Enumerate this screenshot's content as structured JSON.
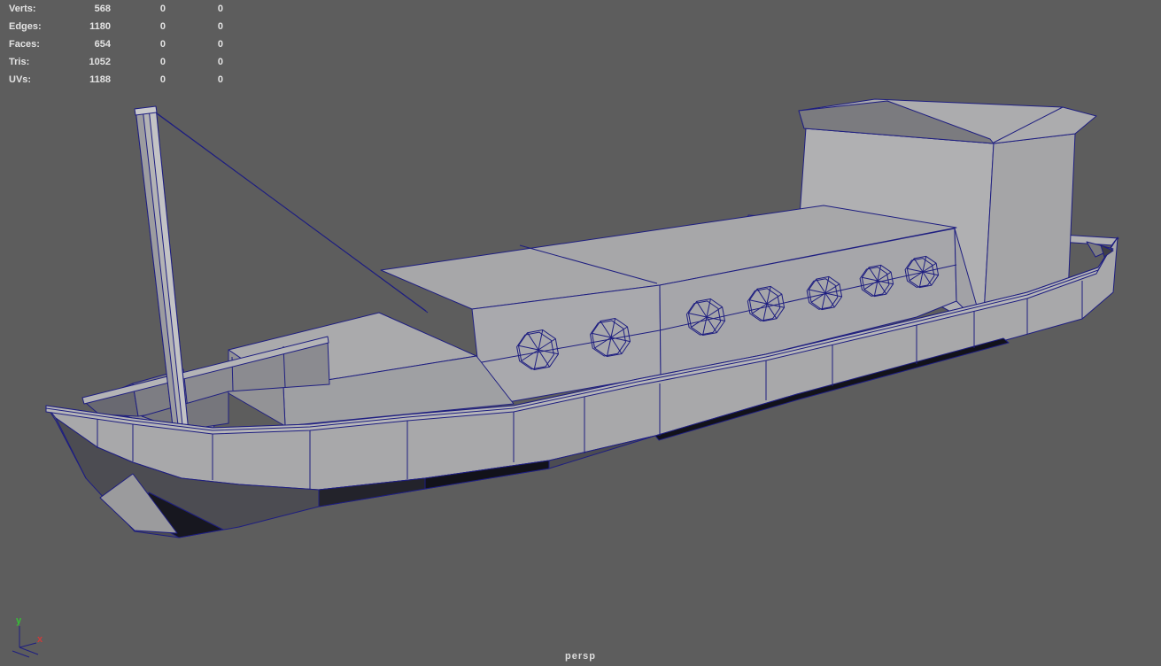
{
  "hud": {
    "rows": [
      {
        "label": "Verts:",
        "value": "568",
        "c2": "0",
        "c3": "0"
      },
      {
        "label": "Edges:",
        "value": "1180",
        "c2": "0",
        "c3": "0"
      },
      {
        "label": "Faces:",
        "value": "654",
        "c2": "0",
        "c3": "0"
      },
      {
        "label": "Tris:",
        "value": "1052",
        "c2": "0",
        "c3": "0"
      },
      {
        "label": "UVs:",
        "value": "1188",
        "c2": "0",
        "c3": "0"
      }
    ]
  },
  "camera": {
    "label": "persp"
  },
  "axis_gizmo": {
    "x_label": "x",
    "y_label": "y"
  },
  "colors": {
    "viewport_background": "#5d5d5d",
    "wireframe": "#1e1e80",
    "surface_light": "#a9a9ab",
    "surface_shadow": "#17171f",
    "hud_text": "#e3e3e3",
    "axis_x": "#cc3b3b",
    "axis_y": "#35c135",
    "axis_z": "#3c55d8"
  }
}
